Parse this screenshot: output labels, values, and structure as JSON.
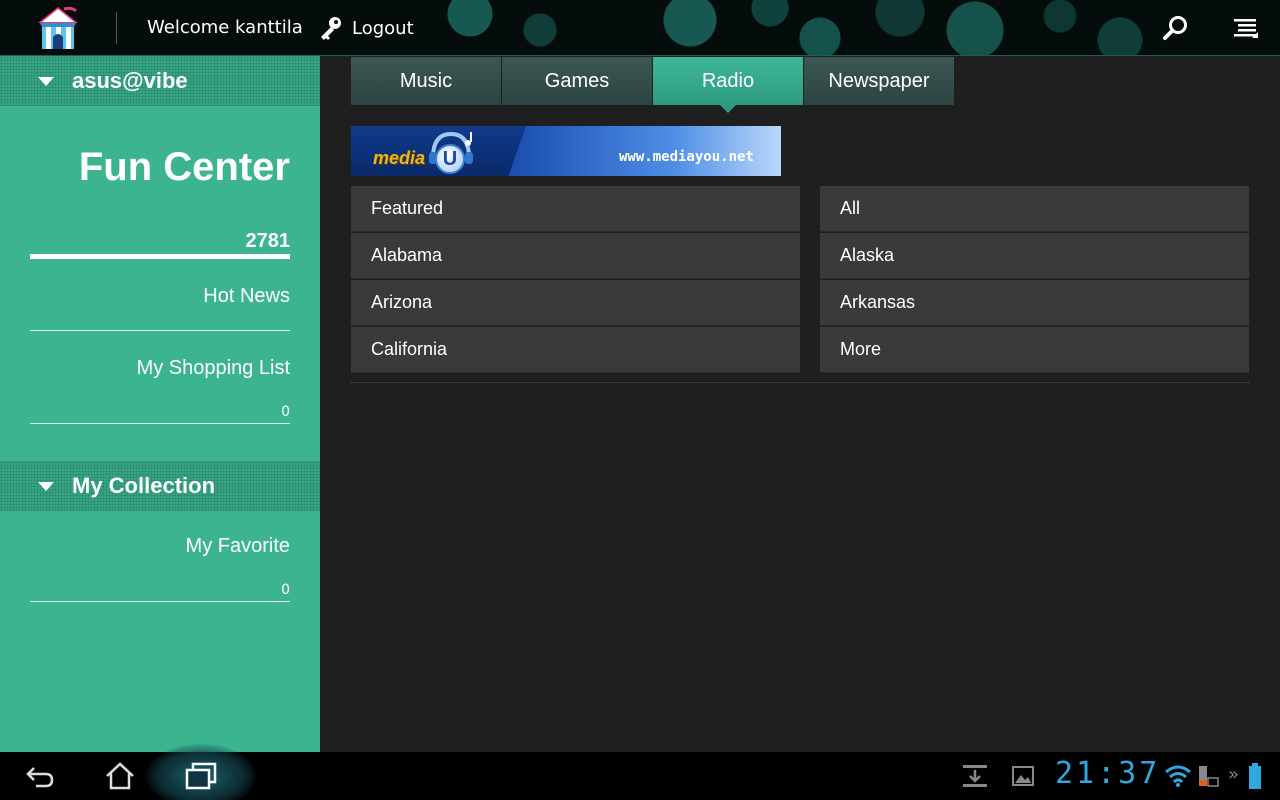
{
  "header": {
    "welcome_text": "Welcome kanttila",
    "logout_label": "Logout",
    "icons": [
      "carnival-tent-icon",
      "key-icon",
      "search-icon",
      "menu-list-icon"
    ]
  },
  "sidebar": {
    "account_header": "asus@vibe",
    "title": "Fun Center",
    "count": "2781",
    "hot_news": "Hot News",
    "shopping_list": "My Shopping List",
    "shopping_count": "0",
    "collection_header": "My Collection",
    "favorite": "My Favorite",
    "favorite_count": "0"
  },
  "tabs": [
    {
      "label": "Music",
      "active": false
    },
    {
      "label": "Games",
      "active": false
    },
    {
      "label": "Radio",
      "active": true
    },
    {
      "label": "Newspaper",
      "active": false
    }
  ],
  "banner": {
    "brand": "media",
    "brand_letter": "U",
    "url": "www.mediayou.net"
  },
  "categories": [
    [
      "Featured",
      "All"
    ],
    [
      "Alabama",
      "Alaska"
    ],
    [
      "Arizona",
      "Arkansas"
    ],
    [
      "California",
      "More"
    ]
  ],
  "system_bar": {
    "clock": "21:37",
    "icons": [
      "back-icon",
      "home-icon",
      "recent-apps-icon",
      "download-icon",
      "gallery-icon",
      "wifi-icon",
      "battery-icon"
    ]
  },
  "colors": {
    "accent": "#3bb48f",
    "tab_active": "#3fb79a",
    "tab_inactive": "#3b5653",
    "clock": "#2fa8e0"
  }
}
